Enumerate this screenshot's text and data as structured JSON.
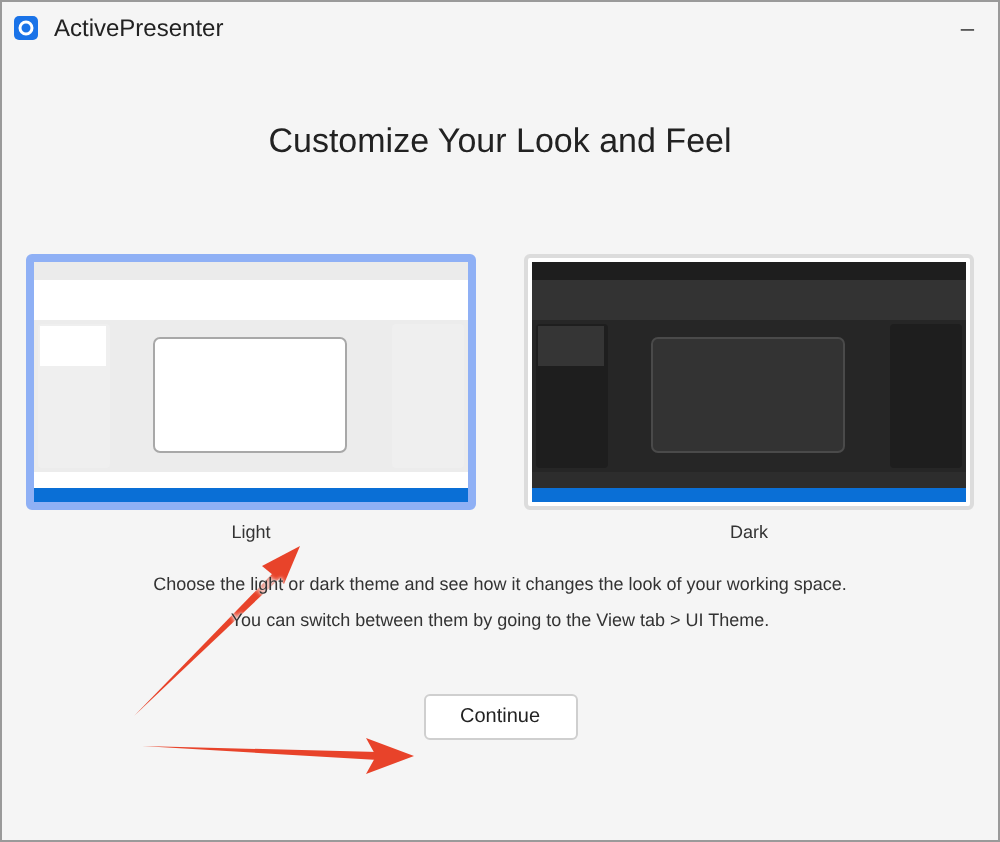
{
  "window": {
    "title": "ActivePresenter",
    "minimize": "–"
  },
  "heading": "Customize Your Look and Feel",
  "themes": [
    {
      "kind": "light",
      "label": "Light",
      "selected": true
    },
    {
      "kind": "dark",
      "label": "Dark",
      "selected": false
    }
  ],
  "description": [
    "Choose the light or dark theme and see how it changes the look of your working space.",
    "You can switch between them by going to the View tab > UI Theme."
  ],
  "buttons": [
    "Continue"
  ]
}
